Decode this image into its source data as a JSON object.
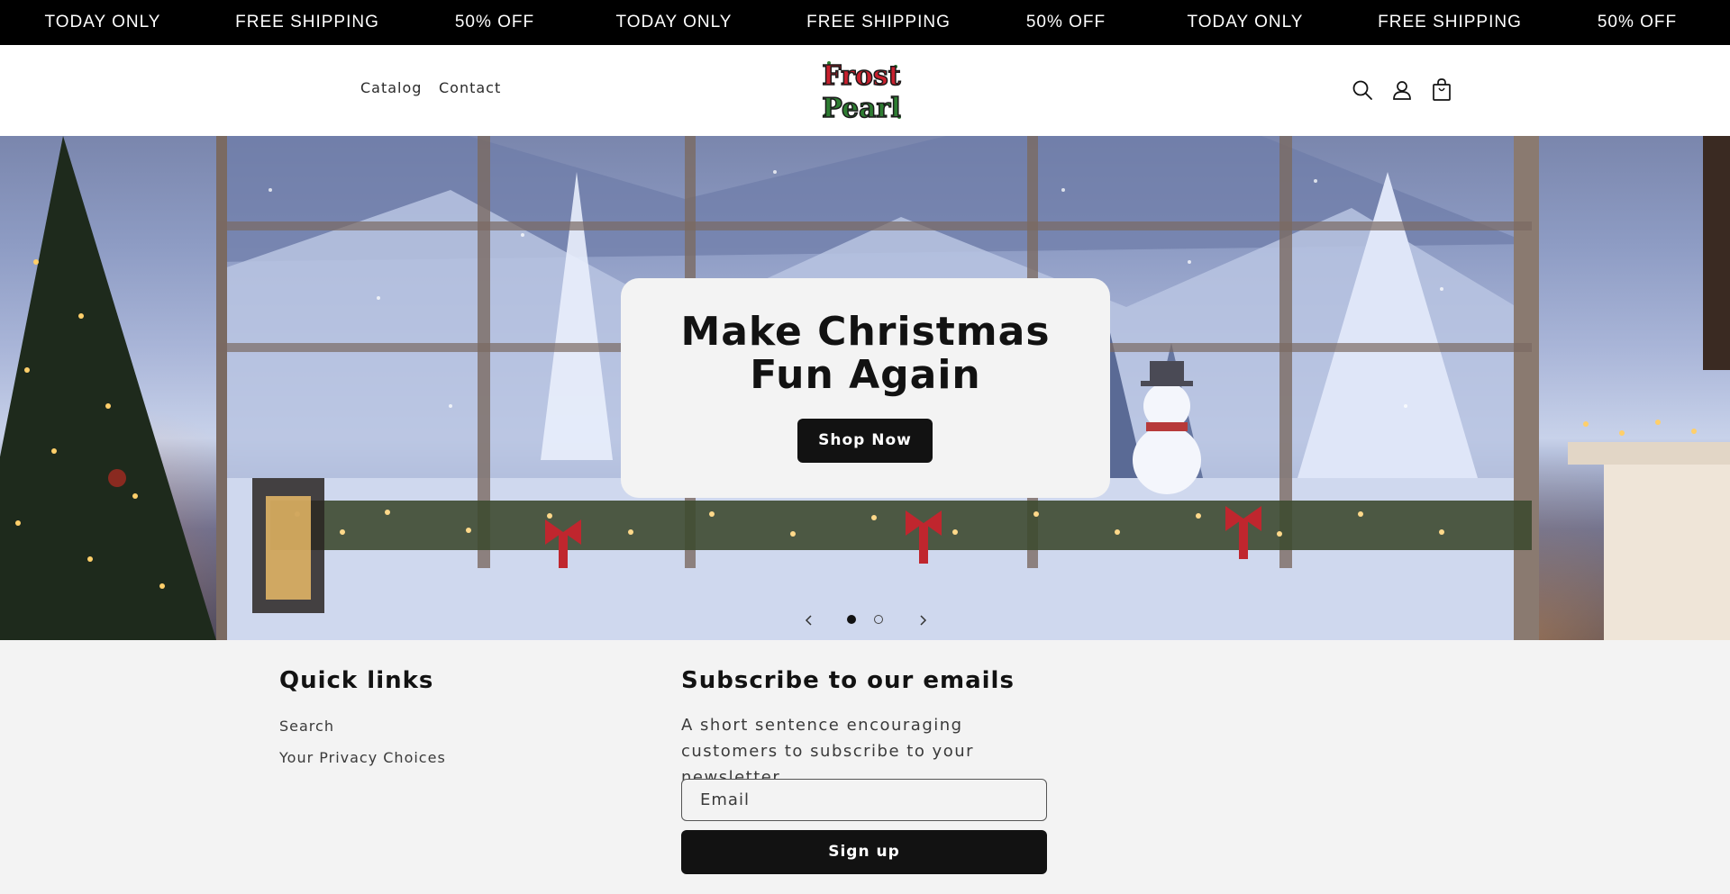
{
  "announcement": {
    "items": [
      "TODAY ONLY",
      "FREE SHIPPING",
      "50% OFF",
      "TODAY ONLY",
      "FREE SHIPPING",
      "50% OFF",
      "TODAY ONLY",
      "FREE SHIPPING",
      "50% OFF"
    ]
  },
  "header": {
    "nav": [
      "Catalog",
      "Contact"
    ],
    "logo_text": [
      "Frost",
      "Pearl"
    ],
    "icons": [
      "search-icon",
      "account-icon",
      "cart-icon"
    ]
  },
  "hero": {
    "title": "Make Christmas Fun Again",
    "button_label": "Shop Now",
    "slides_total": 2,
    "active_slide": 1
  },
  "footer": {
    "quick_links": {
      "heading": "Quick links",
      "items": [
        "Search",
        "Your Privacy Choices"
      ]
    },
    "newsletter": {
      "heading": "Subscribe to our emails",
      "text": "A short sentence encouraging customers to subscribe to your newsletter.",
      "email_placeholder": "Email",
      "button_label": "Sign up"
    }
  },
  "colors": {
    "bar": "#000000",
    "button": "#121212",
    "background": "#f3f3f3",
    "logo_red": "#c8202e",
    "logo_green": "#2e7d32"
  }
}
